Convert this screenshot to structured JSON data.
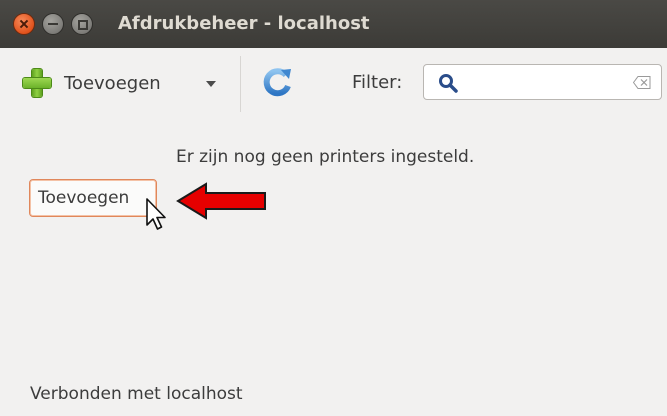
{
  "window": {
    "title": "Afdrukbeheer - localhost"
  },
  "toolbar": {
    "add_label": "Toevoegen",
    "filter_label": "Filter:",
    "filter_value": "",
    "filter_placeholder": ""
  },
  "main": {
    "empty_message": "Er zijn nog geen printers ingesteld.",
    "add_button_label": "Toevoegen"
  },
  "status": {
    "text": "Verbonden met localhost"
  },
  "icons": {
    "add": "plus-icon",
    "dropdown": "chevron-down-icon",
    "refresh": "refresh-icon",
    "search": "search-icon",
    "clear": "clear-icon",
    "annotation": "red-arrow-icon",
    "cursor": "cursor-icon"
  },
  "colors": {
    "titlebar": "#3c3b37",
    "close_button": "#e0521c",
    "button_focus_border": "#e0875b",
    "arrow": "#e60000",
    "background": "#f2f1f0"
  }
}
